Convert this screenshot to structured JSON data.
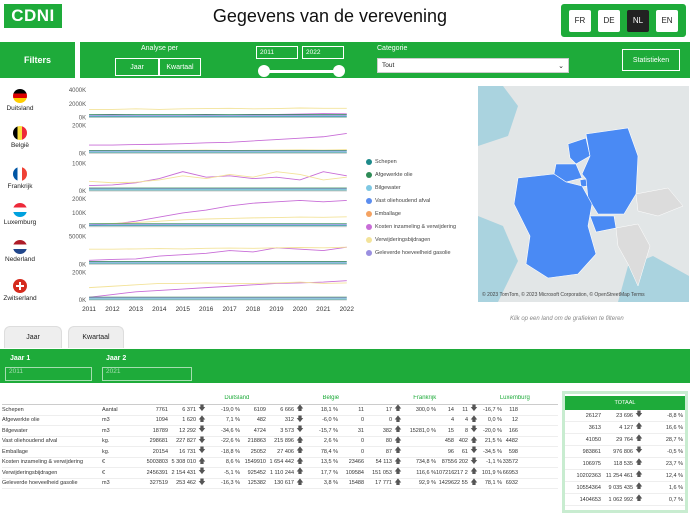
{
  "app": {
    "logo": "CDNI",
    "title": "Gegevens van de verevening"
  },
  "languages": [
    {
      "code": "FR",
      "active": false
    },
    {
      "code": "DE",
      "active": false
    },
    {
      "code": "NL",
      "active": true
    },
    {
      "code": "EN",
      "active": false
    }
  ],
  "filters": {
    "label": "Filters"
  },
  "analysis": {
    "label": "Analyse per",
    "jaar": "Jaar",
    "kwartaal": "Kwartaal"
  },
  "years": {
    "from": "2011",
    "to": "2022"
  },
  "categorie": {
    "label": "Categorie",
    "value": "Tout"
  },
  "statistics_button": "Statistieken",
  "countries": [
    {
      "name": "Duitsland",
      "flag": "de",
      "ticks": [
        "4000K",
        "2000K",
        "0K"
      ]
    },
    {
      "name": "België",
      "flag": "be",
      "ticks": [
        "200K",
        "0K"
      ]
    },
    {
      "name": "Frankrijk",
      "flag": "fr",
      "ticks": [
        "100K",
        "0K"
      ]
    },
    {
      "name": "Luxemburg",
      "flag": "lu",
      "ticks": [
        "200K",
        "100K",
        "0K"
      ]
    },
    {
      "name": "Nederland",
      "flag": "nl",
      "ticks": [
        "5000K",
        "0K"
      ]
    },
    {
      "name": "Zwitserland",
      "flag": "ch",
      "ticks": [
        "200K",
        "0K"
      ]
    }
  ],
  "chart_data": {
    "type": "line",
    "x": [
      2011,
      2012,
      2013,
      2014,
      2015,
      2016,
      2017,
      2018,
      2019,
      2020,
      2021,
      2022
    ],
    "series_colors": {
      "Schepen": "#1d8a8a",
      "Afgewerkte olie": "#2e8b57",
      "Bilgewater": "#7ec8e3",
      "Vast oliehoudend afval": "#5b8def",
      "Emballage": "#f4a261",
      "Kosten inzameling & verwijdering": "#c86dd7",
      "Verwijderingsbijdragen": "#f3e39a",
      "Geleverde hoeveelheid gasolie": "#9a8fe0"
    },
    "legend": [
      "Schepen",
      "Afgewerkte olie",
      "Bilgewater",
      "Vast oliehoudend afval",
      "Emballage",
      "Kosten inzameling & verwijdering",
      "Verwijderingsbijdragen",
      "Geleverde hoeveelheid gasolie"
    ]
  },
  "map": {
    "credit": "© 2023 TomTom, © 2023 Microsoft Corporation, © OpenStreetMap Terms",
    "hint": "Klik op een land om de grafieken te filteren",
    "brand": "Microsoft Bing"
  },
  "tabs": [
    {
      "label": "Jaar"
    },
    {
      "label": "Kwartaal"
    }
  ],
  "period": {
    "jaar1_label": "Jaar 1",
    "jaar1_value": "2011",
    "jaar2_label": "Jaar 2",
    "jaar2_value": "2021"
  },
  "table": {
    "country_headers": [
      "Duitsland",
      "België",
      "Frankrijk",
      "Luxemburg"
    ],
    "total_header": "TOTAAL",
    "rows": [
      {
        "label": "Schepen",
        "unit": "Aantal",
        "de": [
          "7761",
          "6 371",
          "-19,0 %"
        ],
        "be": [
          "6109",
          "6 666",
          "18,1 %"
        ],
        "fr": [
          "11",
          "17",
          "300,0 %"
        ],
        "lu": [
          "14",
          "11",
          "-16,7 %",
          "118"
        ],
        "tot": [
          "26127",
          "23 696",
          "-8,8 %"
        ]
      },
      {
        "label": "Afgewerkte olie",
        "unit": "m3",
        "de": [
          "1094",
          "1 620",
          "7,1 %"
        ],
        "be": [
          "482",
          "312",
          "-6,0 %"
        ],
        "fr": [
          "0",
          "0",
          ""
        ],
        "lu": [
          "4",
          "4",
          "0,0 %",
          "12"
        ],
        "tot": [
          "3613",
          "4 127",
          "16,6 %"
        ]
      },
      {
        "label": "Bilgewater",
        "unit": "m3",
        "de": [
          "18789",
          "12 292",
          "-34,6 %"
        ],
        "be": [
          "4724",
          "3 573",
          "-15,7 %"
        ],
        "fr": [
          "31",
          "382",
          "15281,0 %"
        ],
        "lu": [
          "15",
          "8",
          "-20,0 %",
          "166"
        ],
        "tot": [
          "41050",
          "29 764",
          "28,7 %"
        ]
      },
      {
        "label": "Vast oliehoudend afval",
        "unit": "kg.",
        "de": [
          "298681",
          "227 827",
          "-22,6 %"
        ],
        "be": [
          "218863",
          "215 896",
          "2,6 %"
        ],
        "fr": [
          "0",
          "80",
          ""
        ],
        "lu": [
          "458",
          "402",
          "21,5 %",
          "4482"
        ],
        "tot": [
          "983861",
          "976 806",
          "-0,5 %"
        ]
      },
      {
        "label": "Emballage",
        "unit": "kg.",
        "de": [
          "20154",
          "16 731",
          "-18,8 %"
        ],
        "be": [
          "25052",
          "27 406",
          "78,4 %"
        ],
        "fr": [
          "0",
          "87",
          ""
        ],
        "lu": [
          "96",
          "61",
          "-34,5 %",
          "598"
        ],
        "tot": [
          "106975",
          "118 535",
          "23,7 %"
        ]
      },
      {
        "label": "Kosten inzameling & verwijdering",
        "unit": "€",
        "de": [
          "5003803",
          "5 308 010",
          "8,6 %"
        ],
        "be": [
          "1549910",
          "1 654 442",
          "13,5 %"
        ],
        "fr": [
          "23466",
          "54 113",
          "734,8 %"
        ],
        "lu": [
          "8755",
          "6 202",
          "-1,1 %",
          "33572"
        ],
        "tot": [
          "10202363",
          "11 254 461",
          "12,4 %"
        ]
      },
      {
        "label": "Verwijderingsbijdragen",
        "unit": "€",
        "de": [
          "2456391",
          "2 154 431",
          "-5,1 %"
        ],
        "be": [
          "925452",
          "1 110 244",
          "17,7 %"
        ],
        "fr": [
          "109584",
          "151 053",
          "116,6 %"
        ],
        "lu": [
          "107216",
          "217 293",
          "101,9 %",
          "66953"
        ],
        "tot": [
          "10554364",
          "9 035 435",
          "1,6 %"
        ]
      },
      {
        "label": "Geleverde hoeveelheid gasolie",
        "unit": "m3",
        "de": [
          "327519",
          "253 462",
          "-16,3 %"
        ],
        "be": [
          "125382",
          "130 617",
          "3,8 %"
        ],
        "fr": [
          "15488",
          "17 771",
          "92,9 %"
        ],
        "lu": [
          "14296",
          "22 554",
          "78,1 %",
          "6932"
        ],
        "tot": [
          "1404653",
          "1 062 992",
          "0,7 %"
        ]
      }
    ]
  }
}
